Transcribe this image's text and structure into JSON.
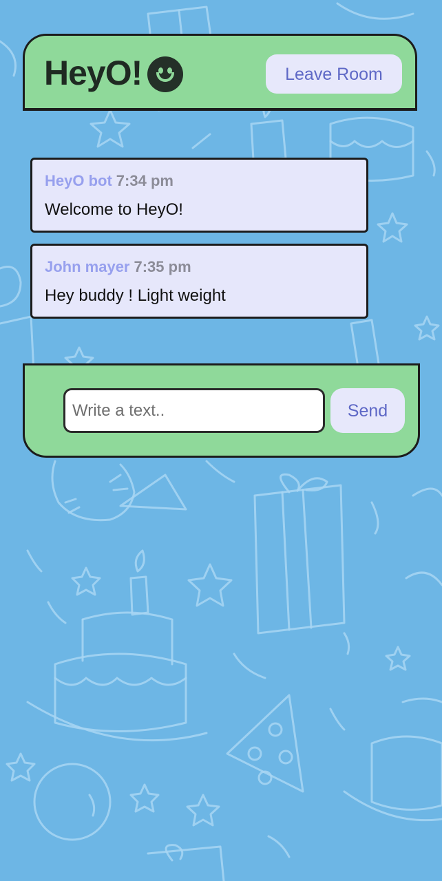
{
  "header": {
    "title": "HeyO!",
    "title_icon": "smiley-face-icon",
    "leave_label": "Leave Room"
  },
  "messages": [
    {
      "author": "HeyO bot",
      "time": "7:34 pm",
      "text": "Welcome to HeyO!"
    },
    {
      "author": "John mayer",
      "time": "7:35 pm",
      "text": "Hey buddy ! Light weight"
    }
  ],
  "composer": {
    "placeholder": "Write a text..",
    "value": "",
    "send_label": "Send"
  },
  "colors": {
    "background": "#6db6e5",
    "panel_green": "#8fd99a",
    "bubble": "#e6e7fb",
    "author": "#97a0ee",
    "button_text": "#5e68c6"
  }
}
